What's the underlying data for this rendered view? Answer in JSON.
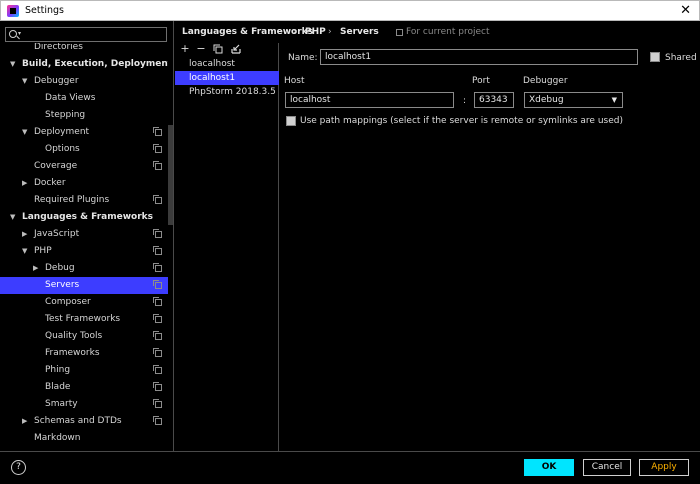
{
  "window": {
    "title": "Settings",
    "close_glyph": "✕"
  },
  "search": {
    "value": "",
    "placeholder": ""
  },
  "tree": [
    {
      "label": "Directories",
      "indent": 2,
      "arrow": "",
      "bold": false,
      "copy": false,
      "cut": true
    },
    {
      "label": "Build, Execution, Deployment",
      "indent": 1,
      "arrow": "down",
      "bold": true,
      "copy": false
    },
    {
      "label": "Debugger",
      "indent": 2,
      "arrow": "down",
      "bold": false,
      "copy": false
    },
    {
      "label": "Data Views",
      "indent": 3,
      "arrow": "",
      "bold": false,
      "copy": false
    },
    {
      "label": "Stepping",
      "indent": 3,
      "arrow": "",
      "bold": false,
      "copy": false
    },
    {
      "label": "Deployment",
      "indent": 2,
      "arrow": "down",
      "bold": false,
      "copy": true
    },
    {
      "label": "Options",
      "indent": 3,
      "arrow": "",
      "bold": false,
      "copy": true
    },
    {
      "label": "Coverage",
      "indent": 2,
      "arrow": "",
      "bold": false,
      "copy": true
    },
    {
      "label": "Docker",
      "indent": 2,
      "arrow": "right",
      "bold": false,
      "copy": false
    },
    {
      "label": "Required Plugins",
      "indent": 2,
      "arrow": "",
      "bold": false,
      "copy": true
    },
    {
      "label": "Languages & Frameworks",
      "indent": 1,
      "arrow": "down",
      "bold": true,
      "copy": false
    },
    {
      "label": "JavaScript",
      "indent": 2,
      "arrow": "right",
      "bold": false,
      "copy": true
    },
    {
      "label": "PHP",
      "indent": 2,
      "arrow": "down",
      "bold": false,
      "copy": true
    },
    {
      "label": "Debug",
      "indent": 3,
      "arrow": "right",
      "bold": false,
      "copy": true
    },
    {
      "label": "Servers",
      "indent": 3,
      "arrow": "",
      "bold": false,
      "copy": true,
      "selected": true
    },
    {
      "label": "Composer",
      "indent": 3,
      "arrow": "",
      "bold": false,
      "copy": true
    },
    {
      "label": "Test Frameworks",
      "indent": 3,
      "arrow": "",
      "bold": false,
      "copy": true
    },
    {
      "label": "Quality Tools",
      "indent": 3,
      "arrow": "",
      "bold": false,
      "copy": true
    },
    {
      "label": "Frameworks",
      "indent": 3,
      "arrow": "",
      "bold": false,
      "copy": true
    },
    {
      "label": "Phing",
      "indent": 3,
      "arrow": "",
      "bold": false,
      "copy": true
    },
    {
      "label": "Blade",
      "indent": 3,
      "arrow": "",
      "bold": false,
      "copy": true
    },
    {
      "label": "Smarty",
      "indent": 3,
      "arrow": "",
      "bold": false,
      "copy": true
    },
    {
      "label": "Schemas and DTDs",
      "indent": 2,
      "arrow": "right",
      "bold": false,
      "copy": true
    },
    {
      "label": "Markdown",
      "indent": 2,
      "arrow": "",
      "bold": false,
      "copy": false
    }
  ],
  "breadcrumb": {
    "items": [
      "Languages & Frameworks",
      "PHP",
      "Servers"
    ],
    "separator": "›",
    "project_label": "For current project"
  },
  "servers_toolbar": {
    "add": "+",
    "remove": "−",
    "copy": "copy-icon",
    "import": "import-icon"
  },
  "servers": [
    {
      "label": "loacalhost",
      "selected": false
    },
    {
      "label": "localhost1",
      "selected": true
    },
    {
      "label": "PhpStorm 2018.3.5",
      "selected": false
    }
  ],
  "form": {
    "name_label": "Name:",
    "name_value": "localhost1",
    "shared_label": "Shared",
    "shared_checked": false,
    "host_label": "Host",
    "host_value": "localhost",
    "colon": ":",
    "port_label": "Port",
    "port_value": "63343",
    "debugger_label": "Debugger",
    "debugger_value": "Xdebug",
    "path_mappings_label": "Use path mappings (select if the server is remote or symlinks are used)",
    "path_mappings_checked": false
  },
  "footer": {
    "help": "?",
    "ok": "OK",
    "cancel": "Cancel",
    "apply": "Apply"
  },
  "colors": {
    "selection": "#3d3dff",
    "ok_button": "#00e5ff",
    "apply_text": "#ffb300"
  }
}
